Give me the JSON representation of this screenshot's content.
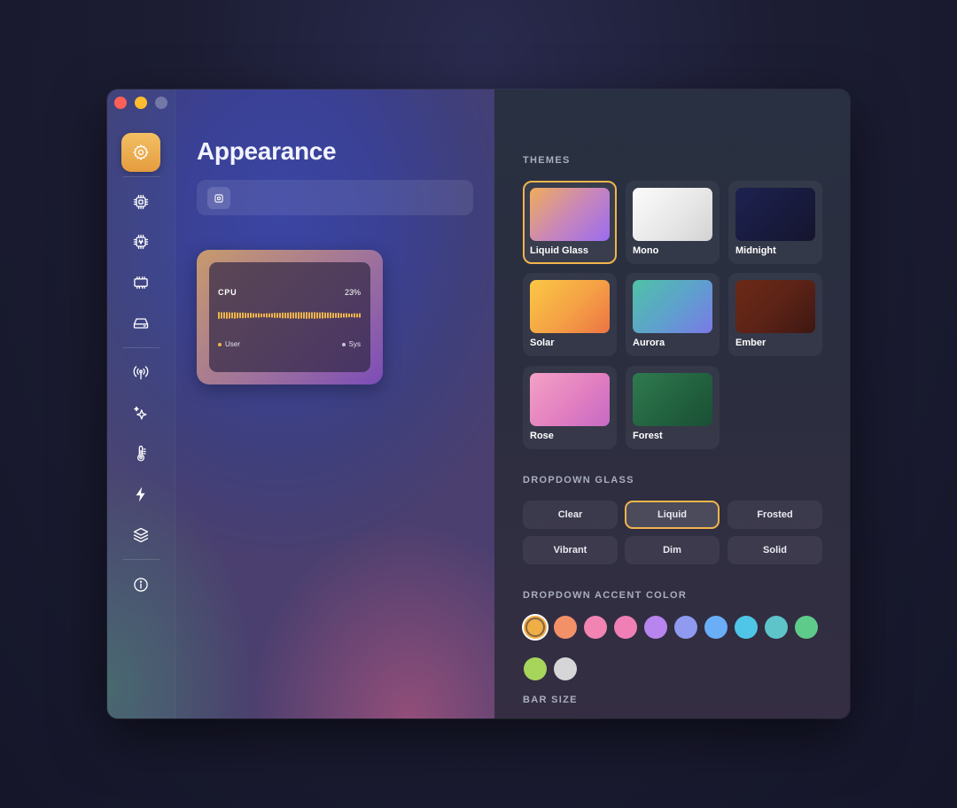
{
  "window": {
    "traffic_lights": [
      "close",
      "minimize",
      "zoom"
    ]
  },
  "sidebar": {
    "items": [
      {
        "name": "settings",
        "icon": "gear-icon",
        "active": true
      },
      {
        "name": "cpu",
        "icon": "cpu-chip-icon",
        "active": false
      },
      {
        "name": "gpu",
        "icon": "gpu-chip-icon",
        "active": false
      },
      {
        "name": "memory",
        "icon": "memory-icon",
        "active": false
      },
      {
        "name": "disk",
        "icon": "disk-icon",
        "active": false
      },
      {
        "name": "network",
        "icon": "antenna-icon",
        "active": false
      },
      {
        "name": "ai",
        "icon": "sparkles-icon",
        "active": false
      },
      {
        "name": "temperature",
        "icon": "thermometer-icon",
        "active": false
      },
      {
        "name": "power",
        "icon": "lightning-icon",
        "active": false
      },
      {
        "name": "layers",
        "icon": "layers-icon",
        "active": false
      },
      {
        "name": "about",
        "icon": "info-icon",
        "active": false
      }
    ]
  },
  "main": {
    "title": "Appearance",
    "toolbar_icon": "chip-icon",
    "preview": {
      "label": "CPU",
      "value": "23%",
      "legend_user": "User",
      "legend_sys": "Sys",
      "user_color": "#f0b54b",
      "sys_color": "#c9c3d6"
    }
  },
  "settings": {
    "themes_title": "THEMES",
    "themes": [
      {
        "name": "Liquid Glass",
        "selected": true
      },
      {
        "name": "Mono",
        "selected": false
      },
      {
        "name": "Midnight",
        "selected": false
      },
      {
        "name": "Solar",
        "selected": false
      },
      {
        "name": "Aurora",
        "selected": false
      },
      {
        "name": "Ember",
        "selected": false
      },
      {
        "name": "Rose",
        "selected": false
      },
      {
        "name": "Forest",
        "selected": false
      }
    ],
    "dropdown_glass_title": "DROPDOWN GLASS",
    "glass_options": [
      {
        "label": "Clear",
        "selected": false
      },
      {
        "label": "Liquid",
        "selected": true
      },
      {
        "label": "Frosted",
        "selected": false
      },
      {
        "label": "Vibrant",
        "selected": false
      },
      {
        "label": "Dim",
        "selected": false
      },
      {
        "label": "Solid",
        "selected": false
      }
    ],
    "accent_title": "DROPDOWN ACCENT COLOR",
    "accent_colors": [
      "#f0ae47",
      "#f29168",
      "#f184b3",
      "#f07fb5",
      "#b884ee",
      "#8f9af0",
      "#69aef7",
      "#4fc6e8",
      "#5ec4c9",
      "#5fcb8a",
      "#a7d45b",
      "#d6d6d8"
    ],
    "accent_selected_index": 0,
    "bar_size_title": "BAR SIZE"
  }
}
